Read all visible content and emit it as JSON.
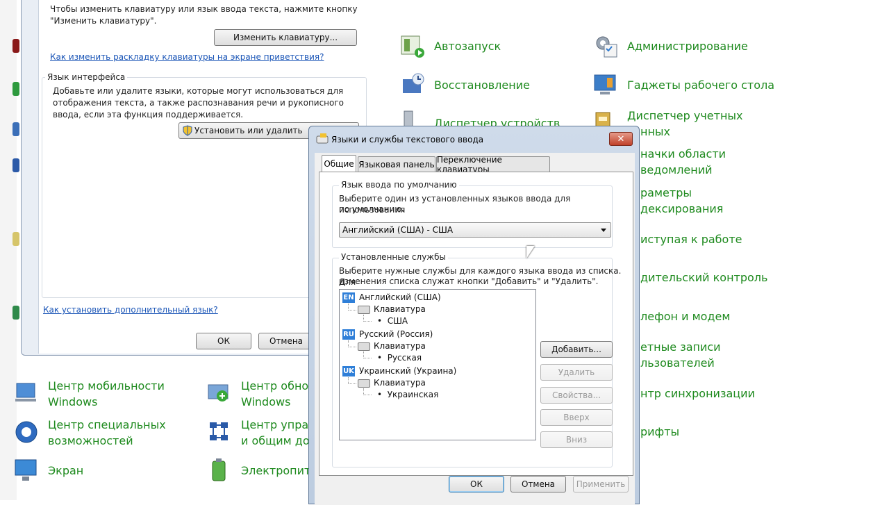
{
  "control_panel": {
    "right_items": [
      {
        "icon": "autorun-icon",
        "label": "Автозапуск"
      },
      {
        "icon": "admin-tools-icon",
        "label": "Администрирование"
      },
      {
        "icon": "recovery-icon",
        "label": "Восстановление"
      },
      {
        "icon": "gadgets-icon",
        "label": "Гаджеты рабочего стола"
      },
      {
        "icon": "device-manager-icon",
        "label": "Диспетчер устройств"
      },
      {
        "icon": "credential-manager-icon",
        "label": "Диспетчер учетных"
      },
      {
        "label": "нных"
      },
      {
        "label": "начки области"
      },
      {
        "label": "ведомлений"
      },
      {
        "label": "раметры"
      },
      {
        "label": "дексирования"
      },
      {
        "label": "иступая к работе"
      },
      {
        "label": "дительский контроль"
      },
      {
        "label": "лефон и модем"
      },
      {
        "label": "етные записи"
      },
      {
        "label": "льзователей"
      },
      {
        "label": "нтр синхронизации"
      },
      {
        "label": "рифты"
      }
    ],
    "bottom_items": [
      {
        "icon": "mobility-center-icon",
        "line1": "Центр мобильности",
        "line2": "Windows"
      },
      {
        "icon": "windows-update-icon",
        "line1": "Центр обно",
        "line2": "Windows"
      },
      {
        "icon": "ease-of-access-icon",
        "line1": "Центр специальных",
        "line2": "возможностей"
      },
      {
        "icon": "network-center-icon",
        "line1": "Центр управ",
        "line2": "и общим до"
      },
      {
        "icon": "display-icon",
        "line1": "Экран"
      },
      {
        "icon": "power-options-icon",
        "line1": "Электропита"
      }
    ]
  },
  "region_dialog": {
    "keyboard_text_1": "Чтобы изменить клавиатуру или язык ввода текста, нажмите кнопку",
    "keyboard_text_2": "\"Изменить клавиатуру\".",
    "change_keyboard_button": "Изменить клавиатуру...",
    "welcome_layout_link": "Как изменить раскладку клавиатуры на экране приветствия?",
    "interface_group_title": "Язык интерфейса",
    "interface_text_1": "Добавьте или удалите языки, которые могут использоваться для",
    "interface_text_2": "отображения текста, а также распознавания речи и рукописного",
    "interface_text_3": "ввода, если эта функция поддерживается.",
    "install_button": "Установить или удалить",
    "additional_language_link": "Как установить дополнительный язык?",
    "ok_button": "ОК",
    "cancel_button": "Отмена"
  },
  "lang_dialog": {
    "title": "Языки и службы текстового ввода",
    "close": "✕",
    "tabs": [
      "Общие",
      "Языковая панель",
      "Переключение клавиатуры"
    ],
    "default_group_title": "Язык ввода по умолчанию",
    "default_text_1": "Выберите один из установленных языков ввода для использования",
    "default_text_2": "по умолчанию.",
    "default_value": "Английский (США) - США",
    "services_group_title": "Установленные службы",
    "services_text_1": "Выберите нужные службы для каждого языка ввода из списка. Для",
    "services_text_2": "изменения списка служат кнопки \"Добавить\" и \"Удалить\".",
    "tree": [
      {
        "badge": "EN",
        "lang": "Английский (США)",
        "service": "Клавиатура",
        "layout": "США"
      },
      {
        "badge": "RU",
        "lang": "Русский (Россия)",
        "service": "Клавиатура",
        "layout": "Русская"
      },
      {
        "badge": "UK",
        "lang": "Украинский (Украина)",
        "service": "Клавиатура",
        "layout": "Украинская"
      }
    ],
    "add_button": "Добавить...",
    "remove_button": "Удалить",
    "properties_button": "Свойства...",
    "up_button": "Вверх",
    "down_button": "Вниз",
    "ok_button": "ОК",
    "cancel_button": "Отмена",
    "apply_button": "Применить"
  }
}
